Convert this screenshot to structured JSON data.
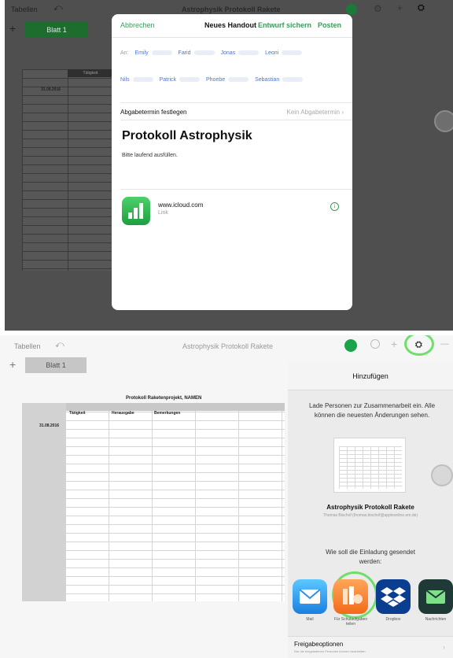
{
  "top": {
    "toolbar": {
      "back_label": "Tabellen",
      "undo": "⤺",
      "title": "Astrophysik Protokoll Rakete",
      "format_icon": "⚙",
      "plus": "+",
      "share": "⛭"
    },
    "sheet_tab": "Blatt 1",
    "sheet_add": "+",
    "grid": {
      "header": "Tätigkeit",
      "date": "31.08.2016"
    },
    "handout": {
      "cancel": "Abbrechen",
      "title": "Neues Handout",
      "save_draft": "Entwurf sichern",
      "post": "Posten",
      "to_label": "An:",
      "recipients_row1": [
        "Emily",
        "Farid",
        "Jonas",
        "Leoni"
      ],
      "recipients_row2": [
        "Nils",
        "Patrick",
        "Phoebe",
        "Sebastian"
      ],
      "due_label": "Abgabetermin festlegen",
      "due_value": "Kein Abgabetermin",
      "due_chevron": "›",
      "heading": "Protokoll Astrophysik",
      "body": "Bitte laufend ausfüllen.",
      "attachment_url": "www.icloud.com",
      "attachment_kind": "Link",
      "info_icon": "i"
    }
  },
  "bottom": {
    "toolbar": {
      "back_label": "Tabellen",
      "undo": "⤺",
      "title": "Astrophysik Protokoll Rakete",
      "plus": "+",
      "share": "⛭",
      "more": "—"
    },
    "sheet_tab": "Blatt 1",
    "sheet_add": "+",
    "sheet_title": "Protokoll Raketenprojekt, NAMEN",
    "columns": [
      "Tätigkeit",
      "Herausgabe",
      "Bemerkungen"
    ],
    "date": "31.08.2016",
    "share_panel": {
      "header": "Hinzufügen",
      "message": "Lade Personen zur Zusammenarbeit ein. Alle können die neuesten Änderungen sehen.",
      "doc_name": "Astrophysik Protokoll Rakete",
      "owner": "Thomas Bischof (thomas.bischof@appleonline.em.de)",
      "how_sent": "Wie soll die Einladung gesendet werden:",
      "apps": [
        {
          "name": "Mail",
          "icon": "mail-icon"
        },
        {
          "name": "Für Schulaufgaben teilen",
          "icon": "schoolwork-icon"
        },
        {
          "name": "Dropbox",
          "icon": "dropbox-icon"
        },
        {
          "name": "Nachrichten",
          "icon": "message-icon"
        }
      ],
      "options_title": "Freigabeoptionen",
      "options_sub": "Nur die eingeladenen Personen können bearbeiten.",
      "options_chevron": "›"
    }
  },
  "colors": {
    "accent_green": "#3b9b59",
    "highlight_ring": "#6ee06a",
    "numbers_green": "#1f9e3f"
  }
}
